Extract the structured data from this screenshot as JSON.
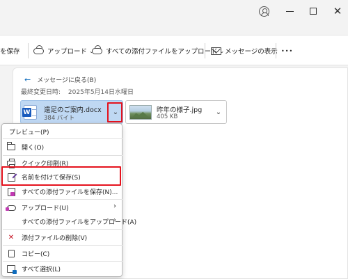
{
  "colors": {
    "accent": "#0f6cbd",
    "highlight": "#e5121d",
    "selected_attachment": "#bfd8f3",
    "delete": "#c50f1f"
  },
  "titlebar": {
    "icons": [
      "avatar-icon",
      "minimize-icon",
      "maximize-icon",
      "close-icon"
    ],
    "close_glyph": "✕"
  },
  "toolbar": {
    "save_partial": "を保存",
    "upload": "アップロード",
    "upload_all": "すべての添付ファイルをアップロード",
    "show_message": "メッセージの表示",
    "more": "•••",
    "chevron": "⌄"
  },
  "message": {
    "back": "メッセージに戻る(B)",
    "back_arrow": "←",
    "modified_label": "最終変更日時:",
    "modified_value": "2025年5月14日水曜日"
  },
  "attachments": [
    {
      "name": "遠足のご案内.docx",
      "size": "384 バイト",
      "icon": "word-icon",
      "selected": true
    },
    {
      "name": "昨年の様子.jpg",
      "size": "405 KB",
      "icon": "image-thumbnail",
      "selected": false
    }
  ],
  "context_menu": {
    "preview": "プレビュー(P)",
    "open": "開く(O)",
    "quick_print": "クイック印刷(R)",
    "save_as": "名前を付けて保存(S)",
    "save_all": "すべての添付ファイルを保存(N)...",
    "upload": "アップロード(U)",
    "upload_all": "すべての添付ファイルをアップロード(A)",
    "delete": "添付ファイルの削除(V)",
    "copy": "コピー(C)",
    "select_all": "すべて選択(L)",
    "submenu_arrow": "›",
    "delete_glyph": "✕"
  }
}
